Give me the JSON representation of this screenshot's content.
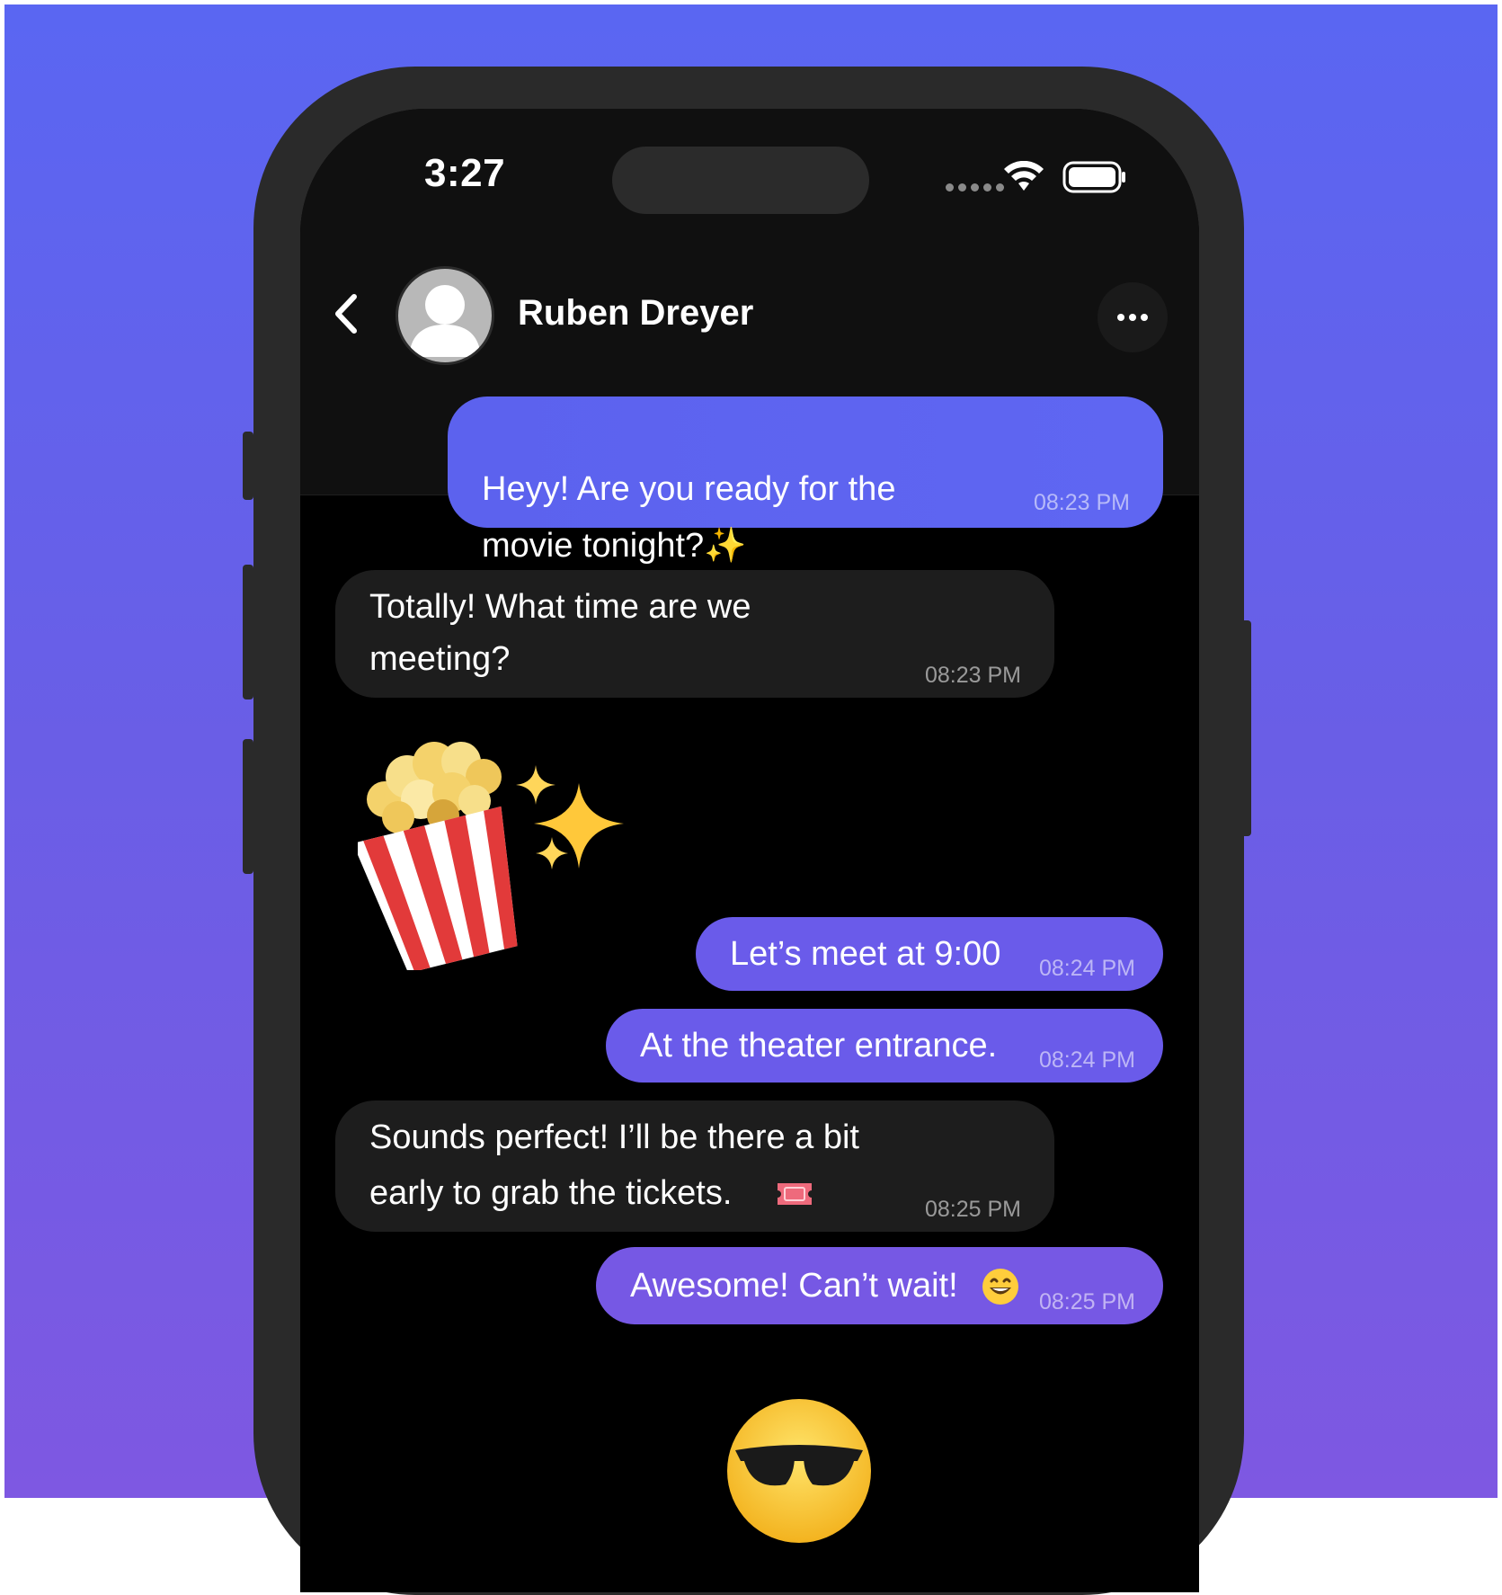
{
  "status_bar": {
    "time": "3:27"
  },
  "header": {
    "contact_name": "Ruben Dreyer"
  },
  "messages": [
    {
      "direction": "outgoing",
      "text": "Heyy! Are you ready for the\nmovie tonight?",
      "emoji": "✨",
      "time": "08:23 PM"
    },
    {
      "direction": "incoming",
      "text": "Totally! What time are we\nmeeting?",
      "time": "08:23 PM"
    },
    {
      "direction": "incoming",
      "sticker": "popcorn-sparkles"
    },
    {
      "direction": "outgoing",
      "text": "Let’s meet at 9:00",
      "time": "08:24 PM"
    },
    {
      "direction": "outgoing",
      "text": "At the theater entrance.",
      "time": "08:24 PM"
    },
    {
      "direction": "incoming",
      "text": "Sounds perfect! I’ll be there a bit\nearly to grab the tickets.",
      "emoji": "ticket-icon",
      "time": "08:25 PM"
    },
    {
      "direction": "outgoing",
      "text": "Awesome! Can’t wait!",
      "emoji": "grinning-face-icon",
      "time": "08:25 PM"
    },
    {
      "direction": "incoming",
      "sticker": "sunglasses-face"
    }
  ],
  "colors": {
    "background_top": "#5a66f2",
    "background_bottom": "#7e58e2",
    "outgoing_bubble": "#6a5bea",
    "incoming_bubble": "#1d1d1d",
    "screen": "#000000"
  }
}
